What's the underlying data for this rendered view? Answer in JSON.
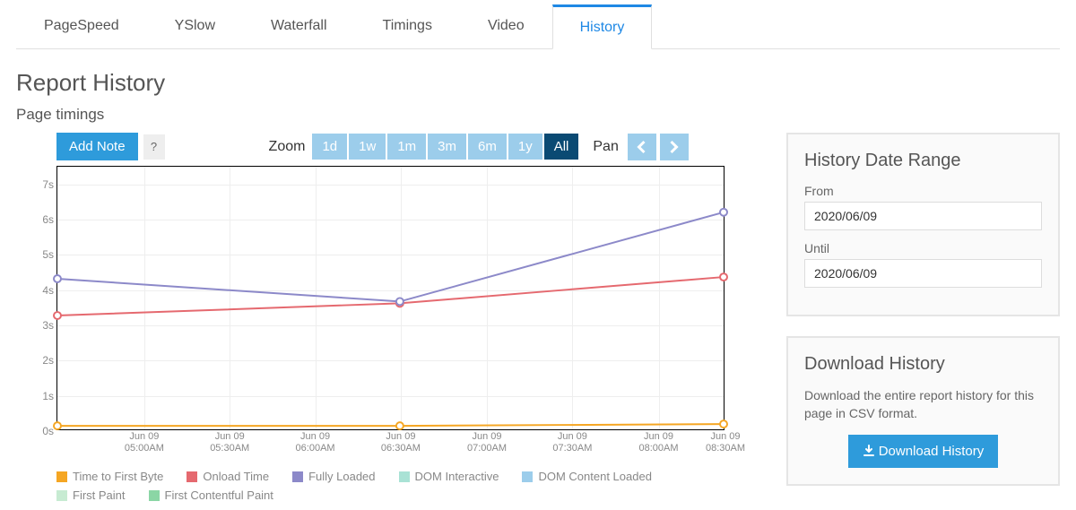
{
  "tabs": [
    "PageSpeed",
    "YSlow",
    "Waterfall",
    "Timings",
    "Video",
    "History"
  ],
  "active_tab": "History",
  "page_title": "Report History",
  "subtitle": "Page timings",
  "buttons": {
    "add_note": "Add Note",
    "help": "?",
    "download": "Download History"
  },
  "zoom": {
    "label": "Zoom",
    "options": [
      "1d",
      "1w",
      "1m",
      "3m",
      "6m",
      "1y",
      "All"
    ],
    "active": "All",
    "pan_label": "Pan"
  },
  "sidebar": {
    "range_title": "History Date Range",
    "from_label": "From",
    "from_value": "2020/06/09",
    "until_label": "Until",
    "until_value": "2020/06/09",
    "download_title": "Download History",
    "download_desc": "Download the entire report history for this page in CSV format."
  },
  "legend_colors": {
    "Time to First Byte": "#F5A623",
    "Onload Time": "#E5696F",
    "Fully Loaded": "#8C89C9",
    "DOM Interactive": "#A9E2D5",
    "DOM Content Loaded": "#9CCDEB",
    "First Paint": "#C7EBD2",
    "First Contentful Paint": "#8BD6A5"
  },
  "chart_data": {
    "type": "line",
    "xlabel": "",
    "ylabel": "",
    "ylim": [
      0,
      7.5
    ],
    "y_ticks": [
      "0s",
      "1s",
      "2s",
      "3s",
      "4s",
      "5s",
      "6s",
      "7s"
    ],
    "x_positions_pct": [
      0,
      13,
      25.8,
      38.6,
      51.4,
      64.3,
      77.1,
      90,
      100
    ],
    "x_tick_labels": [
      "Jun 09\n05:00AM",
      "Jun 09\n05:30AM",
      "Jun 09\n06:00AM",
      "Jun 09\n06:30AM",
      "Jun 09\n07:00AM",
      "Jun 09\n07:30AM",
      "Jun 09\n08:00AM",
      "Jun 09\n08:30AM"
    ],
    "data_x_pct": [
      0,
      51.4,
      100
    ],
    "series": [
      {
        "name": "Time to First Byte",
        "color": "#F5A623",
        "values": [
          0.1,
          0.1,
          0.15
        ]
      },
      {
        "name": "Onload Time",
        "color": "#E5696F",
        "values": [
          3.25,
          3.6,
          4.35
        ]
      },
      {
        "name": "Fully Loaded",
        "color": "#8C89C9",
        "values": [
          4.3,
          3.65,
          6.2
        ]
      }
    ],
    "legend_series": [
      "Time to First Byte",
      "Onload Time",
      "Fully Loaded",
      "DOM Interactive",
      "DOM Content Loaded",
      "First Paint",
      "First Contentful Paint"
    ]
  }
}
